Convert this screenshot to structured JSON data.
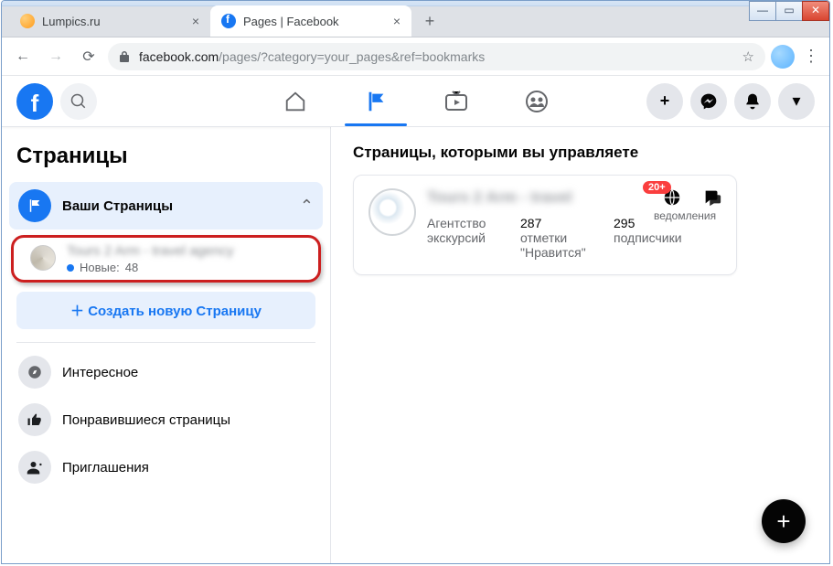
{
  "window": {
    "tabs": [
      {
        "title": "Lumpics.ru",
        "active": false
      },
      {
        "title": "Pages | Facebook",
        "active": true
      }
    ],
    "url_host": "facebook.com",
    "url_path": "/pages/?category=your_pages&ref=bookmarks"
  },
  "fb_nav": {
    "tabs": [
      "home",
      "pages",
      "watch",
      "groups"
    ],
    "active": "pages"
  },
  "sidebar": {
    "title": "Страницы",
    "your_pages": "Ваши Страницы",
    "page_entry": {
      "name": "Tours 2 Arm - travel agency",
      "sub_prefix": "Новые:",
      "sub_count": "48"
    },
    "create": "Создать новую Страницу",
    "items": [
      {
        "label": "Интересное",
        "icon": "compass"
      },
      {
        "label": "Понравившиеся страницы",
        "icon": "like"
      },
      {
        "label": "Приглашения",
        "icon": "invite"
      }
    ]
  },
  "main": {
    "heading": "Страницы, которыми вы управляете",
    "card": {
      "name": "Tours 2 Arm - travel",
      "category": "Агентство экскурсий",
      "likes_num": "287",
      "likes_label": "отметки \"Нравится\"",
      "followers_num": "295",
      "followers_label": "подписчики",
      "badge": "20+",
      "notif_label": "ведомления"
    }
  }
}
